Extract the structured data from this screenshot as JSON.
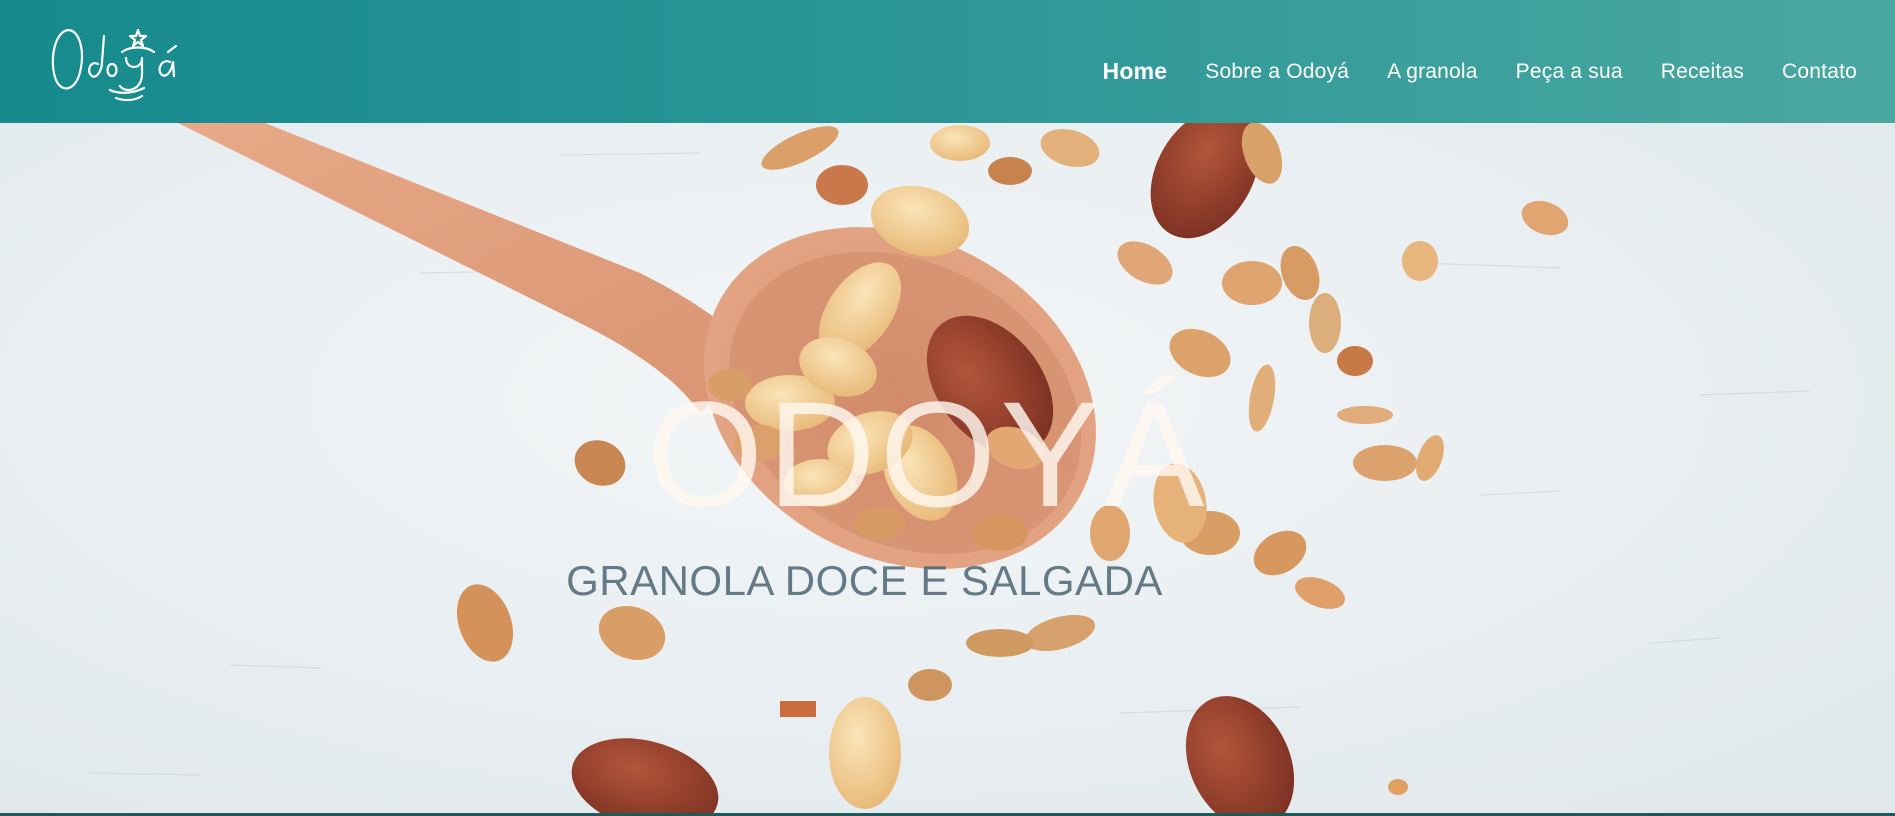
{
  "brand": {
    "logo_text": "Odoyá",
    "logo_icon": "odoya-script-logo"
  },
  "nav": {
    "items": [
      {
        "label": "Home",
        "active": true
      },
      {
        "label": "Sobre a Odoyá",
        "active": false
      },
      {
        "label": "A granola",
        "active": false
      },
      {
        "label": "Peça a sua",
        "active": false
      },
      {
        "label": "Receitas",
        "active": false
      },
      {
        "label": "Contato",
        "active": false
      }
    ]
  },
  "hero": {
    "title": "ODOYÁ",
    "subtitle": "GRANOLA DOCE E SALGADA",
    "image": "granola-with-wooden-spoon"
  },
  "colors": {
    "header_start": "#168a8d",
    "header_end": "#4aa8a0",
    "nav_text": "#ffffff"
  }
}
